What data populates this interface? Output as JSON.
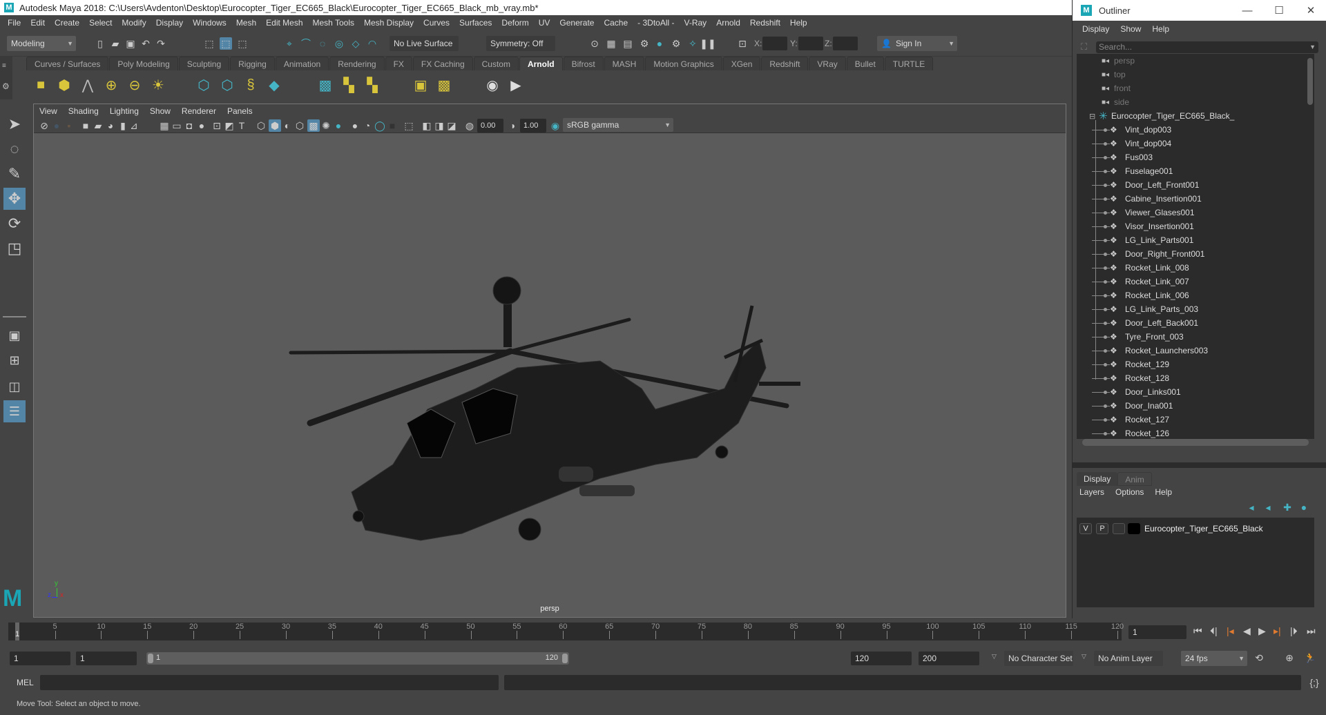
{
  "window": {
    "title": "Autodesk Maya 2018: C:\\Users\\Avdenton\\Desktop\\Eurocopter_Tiger_EC665_Black\\Eurocopter_Tiger_EC665_Black_mb_vray.mb*",
    "logo": "M"
  },
  "menubar": [
    "File",
    "Edit",
    "Create",
    "Select",
    "Modify",
    "Display",
    "Windows",
    "Mesh",
    "Edit Mesh",
    "Mesh Tools",
    "Mesh Display",
    "Curves",
    "Surfaces",
    "Deform",
    "UV",
    "Generate",
    "Cache",
    "- 3DtoAll -",
    "V-Ray",
    "Arnold",
    "Redshift",
    "Help"
  ],
  "statusline": {
    "mode": "Modeling",
    "live_surface": "No Live Surface",
    "symmetry": "Symmetry: Off",
    "x_label": "X:",
    "y_label": "Y:",
    "z_label": "Z:",
    "sign_in": "Sign In"
  },
  "shelf": {
    "tabs": [
      "Curves / Surfaces",
      "Poly Modeling",
      "Sculpting",
      "Rigging",
      "Animation",
      "Rendering",
      "FX",
      "FX Caching",
      "Custom",
      "Arnold",
      "Bifrost",
      "MASH",
      "Motion Graphics",
      "XGen",
      "Redshift",
      "VRay",
      "Bullet",
      "TURTLE"
    ],
    "active_tab": "Arnold"
  },
  "viewport": {
    "menu": [
      "View",
      "Shading",
      "Lighting",
      "Show",
      "Renderer",
      "Panels"
    ],
    "exposure": "0.00",
    "gamma": "1.00",
    "color_space": "sRGB gamma",
    "camera_label": "persp",
    "axis": {
      "x": "x",
      "y": "y",
      "z": "z"
    }
  },
  "outliner": {
    "title": "Outliner",
    "menu": [
      "Display",
      "Show",
      "Help"
    ],
    "search_placeholder": "Search...",
    "cameras": [
      "persp",
      "top",
      "front",
      "side"
    ],
    "root": "Eurocopter_Tiger_EC665_Black_",
    "children": [
      "Vint_dop003",
      "Vint_dop004",
      "Fus003",
      "Fuselage001",
      "Door_Left_Front001",
      "Cabine_Insertion001",
      "Viewer_Glases001",
      "Visor_Insertion001",
      "LG_Link_Parts001",
      "Door_Right_Front001",
      "Rocket_Link_008",
      "Rocket_Link_007",
      "Rocket_Link_006",
      "LG_Link_Parts_003",
      "Door_Left_Back001",
      "Tyre_Front_003",
      "Rocket_Launchers003",
      "Rocket_129",
      "Rocket_128",
      "Door_Links001",
      "Door_Ina001",
      "Rocket_127",
      "Rocket_126"
    ]
  },
  "layers": {
    "tabs": [
      "Display",
      "Anim"
    ],
    "active_tab": "Display",
    "menu": [
      "Layers",
      "Options",
      "Help"
    ],
    "rows": [
      {
        "v": "V",
        "p": "P",
        "color": "#000000",
        "name": "Eurocopter_Tiger_EC665_Black"
      }
    ]
  },
  "timeline": {
    "ticks": [
      5,
      10,
      15,
      20,
      25,
      30,
      35,
      40,
      45,
      50,
      55,
      60,
      65,
      70,
      75,
      80,
      85,
      90,
      95,
      100,
      105,
      110,
      115,
      120
    ],
    "current_frame_marker": "1",
    "current_frame": "1"
  },
  "range": {
    "start": "1",
    "playback_start": "1",
    "slider_start": "1",
    "slider_end": "120",
    "playback_end": "120",
    "end": "200",
    "character_set": "No Character Set",
    "anim_layer": "No Anim Layer",
    "fps": "24 fps"
  },
  "command": {
    "label": "MEL"
  },
  "help_line": "Move Tool: Select an object to move.",
  "colors": {
    "accent": "#5285a6",
    "maya_teal": "#1ba6b6",
    "arnold_yellow": "#d8c53b"
  }
}
